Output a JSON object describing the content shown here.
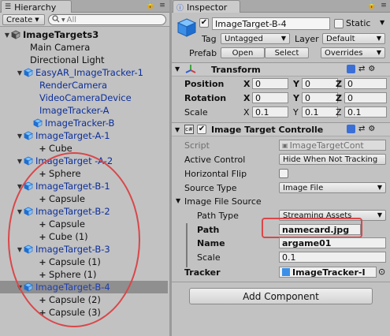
{
  "hierarchy": {
    "tab_label": "Hierarchy",
    "create_label": "Create",
    "search_placeholder": "All",
    "rows": [
      {
        "label": "ImageTargets3",
        "kind": "scene"
      },
      {
        "label": "Main Camera",
        "kind": "plain"
      },
      {
        "label": "Directional Light",
        "kind": "plain"
      },
      {
        "label": "EasyAR_ImageTracker-1",
        "kind": "prefab-parent"
      },
      {
        "label": "RenderCamera",
        "kind": "prefab-child"
      },
      {
        "label": "VideoCameraDevice",
        "kind": "prefab-child"
      },
      {
        "label": "ImageTracker-A",
        "kind": "prefab-child"
      },
      {
        "label": "ImageTracker-B",
        "kind": "prefab-child-mod"
      },
      {
        "label": "ImageTarget-A-1",
        "kind": "target"
      },
      {
        "label": "Cube",
        "kind": "child"
      },
      {
        "label": "ImageTarget -A-2",
        "kind": "target"
      },
      {
        "label": "Sphere",
        "kind": "child"
      },
      {
        "label": "ImageTarget-B-1",
        "kind": "target"
      },
      {
        "label": "Capsule",
        "kind": "child"
      },
      {
        "label": "ImageTarget-B-2",
        "kind": "target"
      },
      {
        "label": "Capsule",
        "kind": "child"
      },
      {
        "label": "Cube (1)",
        "kind": "child"
      },
      {
        "label": "ImageTarget-B-3",
        "kind": "target"
      },
      {
        "label": "Capsule (1)",
        "kind": "child"
      },
      {
        "label": "Sphere (1)",
        "kind": "child"
      },
      {
        "label": "ImageTarget-B-4",
        "kind": "target-selected"
      },
      {
        "label": "Capsule (2)",
        "kind": "child"
      },
      {
        "label": "Capsule (3)",
        "kind": "child"
      }
    ]
  },
  "inspector": {
    "tab_label": "Inspector",
    "object_name": "ImageTarget-B-4",
    "static_label": "Static",
    "tag_label": "Tag",
    "tag_value": "Untagged",
    "layer_label": "Layer",
    "layer_value": "Default",
    "prefab_label": "Prefab",
    "open_label": "Open",
    "select_label": "Select",
    "overrides_label": "Overrides",
    "transform": {
      "title": "Transform",
      "rows": [
        {
          "label": "Position",
          "x": "0",
          "y": "0",
          "z": "0"
        },
        {
          "label": "Rotation",
          "x": "0",
          "y": "0",
          "z": "0"
        },
        {
          "label": "Scale",
          "x": "0.1",
          "y": "0.1",
          "z": "0.1"
        }
      ],
      "axis_x": "X",
      "axis_y": "Y",
      "axis_z": "Z"
    },
    "itc": {
      "title": "Image Target Controlle",
      "script_label": "Script",
      "script_value": "ImageTargetCont",
      "active_control_label": "Active Control",
      "active_control_value": "Hide When Not Tracking",
      "flip_label": "Horizontal Flip",
      "source_type_label": "Source Type",
      "source_type_value": "Image File",
      "file_source_label": "Image File Source",
      "path_type_label": "Path Type",
      "path_type_value": "Streaming Assets",
      "path_label": "Path",
      "path_value": "namecard.jpg",
      "name_label": "Name",
      "name_value": "argame01",
      "scale_label": "Scale",
      "scale_value": "0.1",
      "tracker_label": "Tracker",
      "tracker_value": "ImageTracker-I"
    },
    "add_component_label": "Add Component"
  },
  "colors": {
    "accent_red": "#d9474a",
    "prefab_blue": "#0c2f9a",
    "selection": "#8f8f8f"
  }
}
